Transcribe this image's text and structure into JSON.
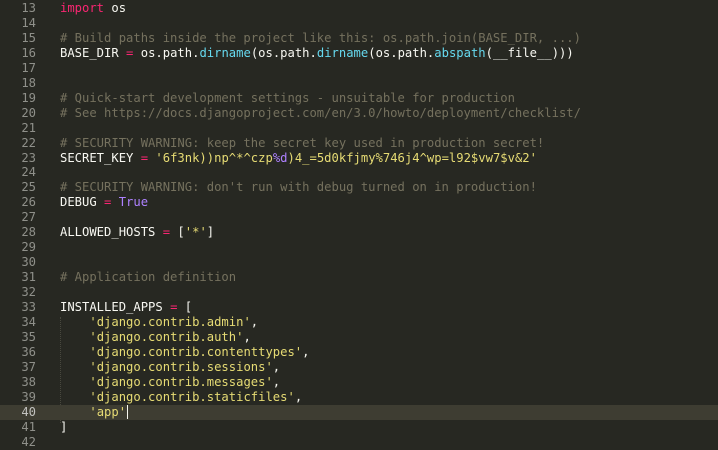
{
  "editor": {
    "current_line": "40",
    "lines": [
      {
        "n": "13",
        "t": [
          [
            "kw",
            "import"
          ],
          [
            "p",
            " os"
          ]
        ]
      },
      {
        "n": "14",
        "t": []
      },
      {
        "n": "15",
        "t": [
          [
            "cmt",
            "# Build paths inside the project like this: os.path.join(BASE_DIR, ...)"
          ]
        ]
      },
      {
        "n": "16",
        "t": [
          [
            "p",
            "BASE_DIR "
          ],
          [
            "kw",
            "="
          ],
          [
            "p",
            " os.path."
          ],
          [
            "fn",
            "dirname"
          ],
          [
            "p",
            "(os.path."
          ],
          [
            "fn",
            "dirname"
          ],
          [
            "p",
            "(os.path."
          ],
          [
            "fn",
            "abspath"
          ],
          [
            "p",
            "(__file__)))"
          ]
        ]
      },
      {
        "n": "17",
        "t": []
      },
      {
        "n": "18",
        "t": []
      },
      {
        "n": "19",
        "t": [
          [
            "cmt",
            "# Quick-start development settings - unsuitable for production"
          ]
        ]
      },
      {
        "n": "20",
        "t": [
          [
            "cmt",
            "# See https://docs.djangoproject.com/en/3.0/howto/deployment/checklist/"
          ]
        ]
      },
      {
        "n": "21",
        "t": []
      },
      {
        "n": "22",
        "t": [
          [
            "cmt",
            "# SECURITY WARNING: keep the secret key used in production secret!"
          ]
        ]
      },
      {
        "n": "23",
        "t": [
          [
            "p",
            "SECRET_KEY "
          ],
          [
            "kw",
            "="
          ],
          [
            "p",
            " "
          ],
          [
            "str",
            "'6f3nk))np^*^czp"
          ],
          [
            "fmt",
            "%d"
          ],
          [
            "str",
            ")4_=5d0kfjmy%746j4^wp=l92$vw7$v&2'"
          ]
        ]
      },
      {
        "n": "24",
        "t": []
      },
      {
        "n": "25",
        "t": [
          [
            "cmt",
            "# SECURITY WARNING: don't run with debug turned on in production!"
          ]
        ]
      },
      {
        "n": "26",
        "t": [
          [
            "p",
            "DEBUG "
          ],
          [
            "kw",
            "="
          ],
          [
            "p",
            " "
          ],
          [
            "const",
            "True"
          ]
        ]
      },
      {
        "n": "27",
        "t": []
      },
      {
        "n": "28",
        "t": [
          [
            "p",
            "ALLOWED_HOSTS "
          ],
          [
            "kw",
            "="
          ],
          [
            "p",
            " ["
          ],
          [
            "str",
            "'*'"
          ],
          [
            "p",
            "]"
          ]
        ]
      },
      {
        "n": "29",
        "t": []
      },
      {
        "n": "30",
        "t": []
      },
      {
        "n": "31",
        "t": [
          [
            "cmt",
            "# Application definition"
          ]
        ]
      },
      {
        "n": "32",
        "t": []
      },
      {
        "n": "33",
        "t": [
          [
            "p",
            "INSTALLED_APPS "
          ],
          [
            "kw",
            "="
          ],
          [
            "p",
            " ["
          ]
        ]
      },
      {
        "n": "34",
        "t": [
          [
            "p",
            "    "
          ],
          [
            "str",
            "'django.contrib.admin'"
          ],
          [
            "p",
            ","
          ]
        ]
      },
      {
        "n": "35",
        "t": [
          [
            "p",
            "    "
          ],
          [
            "str",
            "'django.contrib.auth'"
          ],
          [
            "p",
            ","
          ]
        ]
      },
      {
        "n": "36",
        "t": [
          [
            "p",
            "    "
          ],
          [
            "str",
            "'django.contrib.contenttypes'"
          ],
          [
            "p",
            ","
          ]
        ]
      },
      {
        "n": "37",
        "t": [
          [
            "p",
            "    "
          ],
          [
            "str",
            "'django.contrib.sessions'"
          ],
          [
            "p",
            ","
          ]
        ]
      },
      {
        "n": "38",
        "t": [
          [
            "p",
            "    "
          ],
          [
            "str",
            "'django.contrib.messages'"
          ],
          [
            "p",
            ","
          ]
        ]
      },
      {
        "n": "39",
        "t": [
          [
            "p",
            "    "
          ],
          [
            "str",
            "'django.contrib.staticfiles'"
          ],
          [
            "p",
            ","
          ]
        ]
      },
      {
        "n": "40",
        "t": [
          [
            "p",
            "    "
          ],
          [
            "str",
            "'app'"
          ]
        ]
      },
      {
        "n": "41",
        "t": [
          [
            "p",
            "]"
          ]
        ]
      },
      {
        "n": "42",
        "t": []
      }
    ]
  }
}
